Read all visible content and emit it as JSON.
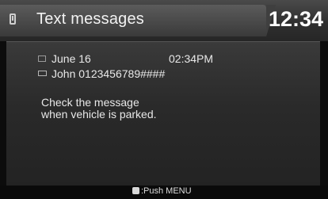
{
  "header": {
    "title": "Text messages",
    "clock": "12:34"
  },
  "message": {
    "date": "June 16",
    "time": "02:34PM",
    "sender": "John 0123456789####",
    "body": "Check the message\nwhen vehicle is parked."
  },
  "footer": {
    "hint": ":Push MENU"
  },
  "icons": {
    "header": "phone-icon",
    "date": "calendar-icon",
    "sender": "message-icon",
    "footer": "menu-button-icon"
  }
}
